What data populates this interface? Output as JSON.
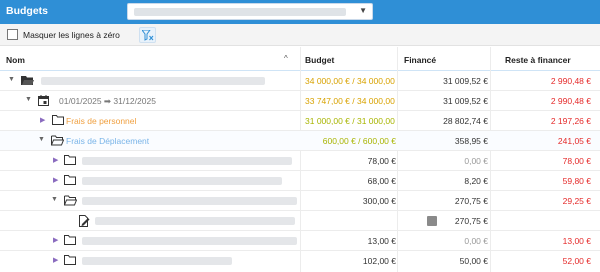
{
  "header": {
    "title": "Budgets"
  },
  "toolbar": {
    "hide_zero_label": "Masquer les lignes à zéro"
  },
  "table": {
    "columns": {
      "nom": "Nom",
      "budget": "Budget",
      "finance": "Financé",
      "reste": "Reste à financer"
    },
    "rows": [
      {
        "label": "",
        "budget": "34 000,00 € / 34 000,00 €",
        "finance": "31 009,52 €",
        "reste": "2 990,48 €"
      },
      {
        "label": "01/01/2025 ➡ 31/12/2025",
        "budget": "33 747,00 € / 34 000,00 €",
        "finance": "31 009,52 €",
        "reste": "2 990,48 €"
      },
      {
        "label": "Frais de personnel",
        "budget": "31 000,00 € / 31 000,00 €",
        "finance": "28 802,74 €",
        "reste": "2 197,26 €"
      },
      {
        "label": "Frais de Déplacement",
        "budget": "600,00 € / 600,00 €",
        "finance": "358,95 €",
        "reste": "241,05 €"
      },
      {
        "label": "",
        "budget": "78,00 €",
        "finance": "0,00 €",
        "reste": "78,00 €"
      },
      {
        "label": "",
        "budget": "68,00 €",
        "finance": "8,20 €",
        "reste": "59,80 €"
      },
      {
        "label": "",
        "budget": "300,00 €",
        "finance": "270,75 €",
        "reste": "29,25 €"
      },
      {
        "label": "",
        "budget": "",
        "finance": "270,75 €",
        "reste": ""
      },
      {
        "label": "",
        "budget": "13,00 €",
        "finance": "0,00 €",
        "reste": "13,00 €"
      },
      {
        "label": "",
        "budget": "102,00 €",
        "finance": "50,00 €",
        "reste": "52,00 €"
      }
    ]
  },
  "colors": {
    "header": "#2f8fd6",
    "gold": "#d8a200",
    "olive": "#a8b400",
    "red": "#e52a2a",
    "orange": "#f0a040",
    "blue": "#79b4e8"
  },
  "icons": [
    "filter-clear-icon",
    "chevron-down-icon",
    "sort-up-icon",
    "folder-icon",
    "folder-open-icon",
    "calendar-icon",
    "document-icon",
    "edit-icon"
  ]
}
